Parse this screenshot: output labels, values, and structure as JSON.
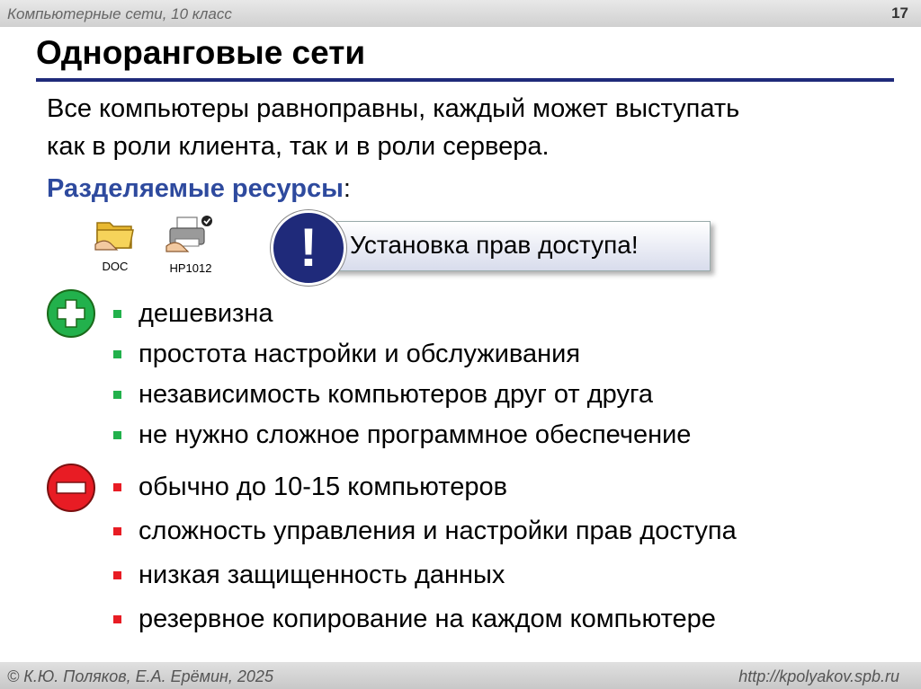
{
  "header": {
    "course": "Компьютерные сети, 10 класс",
    "page_number": "17"
  },
  "title": "Одноранговые сети",
  "intro_lines": [
    "Все компьютеры равноправны, каждый может выступать",
    "как в роли клиента, так и в роли сервера."
  ],
  "resources": {
    "heading": "Разделяемые ресурсы",
    "colon": ":",
    "items": [
      {
        "label": "DOC",
        "icon": "shared-folder-icon"
      },
      {
        "label": "HP1012",
        "icon": "shared-printer-icon"
      }
    ]
  },
  "callout": {
    "icon": "exclamation-icon",
    "text": "Установка прав доступа!"
  },
  "pros": {
    "icon": "plus-icon",
    "items": [
      "дешевизна",
      "простота настройки и обслуживания",
      "независимость компьютеров друг от друга",
      "не нужно сложное программное обеспечение"
    ]
  },
  "cons": {
    "icon": "minus-icon",
    "items": [
      "обычно до 10-15 компьютеров",
      "сложность управления и настройки прав доступа",
      "низкая защищенность данных",
      "резервное копирование на каждом компьютере"
    ]
  },
  "colors": {
    "accent": "#1f2a7a",
    "resources_heading": "#2e4a9e",
    "pro": "#22b14c",
    "con": "#e81c24"
  },
  "footer": {
    "authors": "© К.Ю. Поляков, Е.А. Ерёмин, 2025",
    "url": "http://kpolyakov.spb.ru"
  }
}
